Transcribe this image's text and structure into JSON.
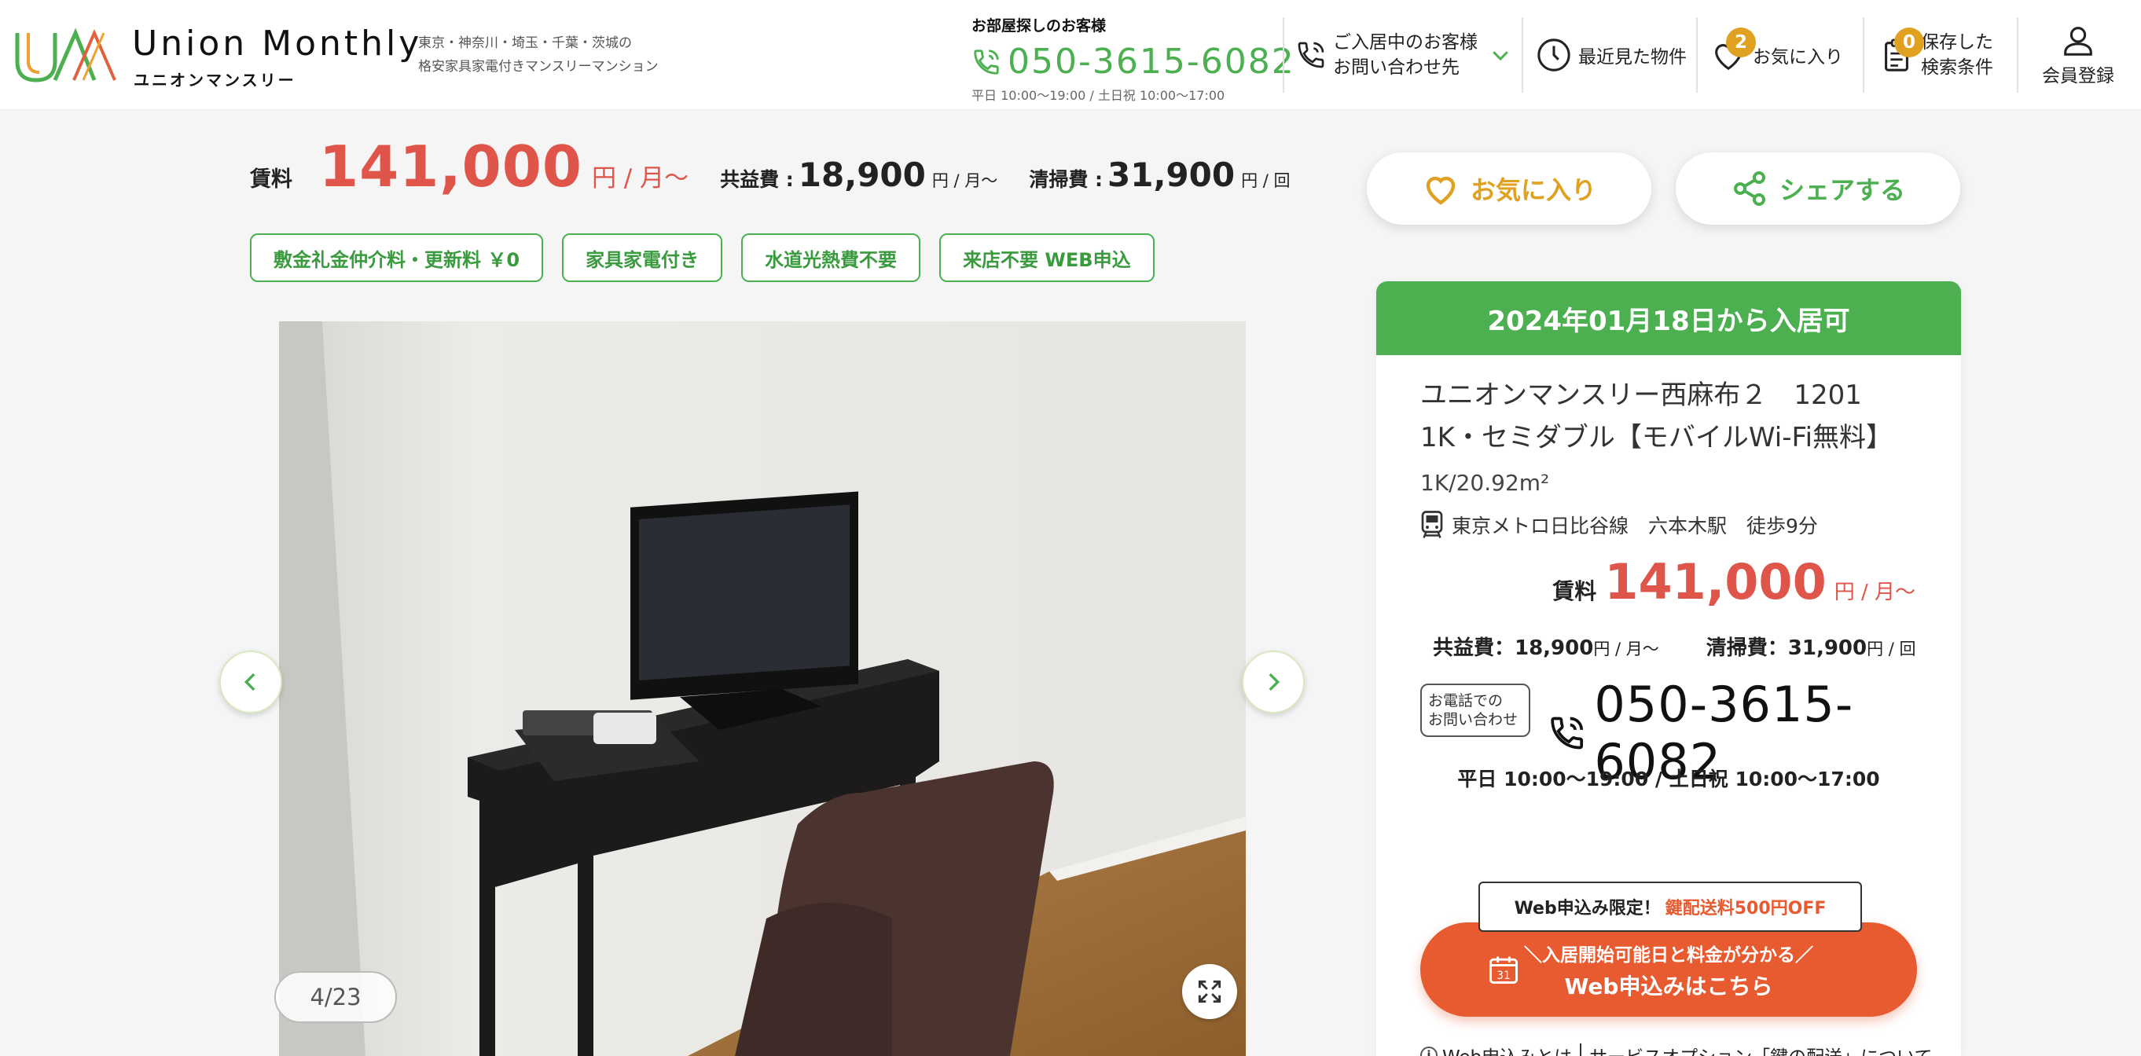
{
  "header": {
    "logo_title": "Union Monthly",
    "logo_sub": "ユニオンマンスリー",
    "tagline_line1": "東京・神奈川・埼玉・千葉・茨城の",
    "tagline_line2": "格安家具家電付きマンスリーマンション",
    "phone_label": "お部屋探しのお客様",
    "phone_number": "050-3615-6082",
    "phone_hours": "平日 10:00〜19:00 / 土日祝 10:00〜17:00",
    "nav": {
      "resident_line1": "ご入居中のお客様",
      "resident_line2": "お問い合わせ先",
      "recent": "最近見た物件",
      "favorites": "お気に入り",
      "favorites_count": "2",
      "saved_line1": "保存した",
      "saved_line2": "検索条件",
      "saved_count": "0",
      "register": "会員登録"
    }
  },
  "pricing": {
    "rent_label": "賃料",
    "rent_value": "141,000",
    "rent_unit": "円 / 月〜",
    "common_fee_label": "共益費 :",
    "common_fee_value": "18,900",
    "common_fee_unit": "円 / 月〜",
    "cleaning_fee_label": "清掃費 :",
    "cleaning_fee_value": "31,900",
    "cleaning_fee_unit": "円 / 回"
  },
  "tags": [
    "敷金礼金仲介料・更新料 ￥0",
    "家具家電付き",
    "水道光熱費不要",
    "来店不要 WEB申込"
  ],
  "gallery": {
    "counter": "4/23"
  },
  "actions": {
    "favorite_label": "お気に入り",
    "share_label": "シェアする"
  },
  "card": {
    "availability": "2024年01月18日から入居可",
    "title": "ユニオンマンスリー西麻布２　1201 1K・セミダブル【モバイルWi-Fi無料】",
    "size": "1K/20.92m²",
    "station": "東京メトロ日比谷線　六本木駅　徒歩9分",
    "rent_label": "賃料",
    "rent_value": "141,000",
    "rent_unit": "円 / 月〜",
    "common_fee": "共益費：18,900",
    "common_fee_unit": "円 / 月〜",
    "cleaning_fee": "清掃費：31,900",
    "cleaning_fee_unit": "円 / 回",
    "contact_line1": "お電話での",
    "contact_line2": "お問い合わせ",
    "phone_number": "050-3615-6082",
    "hours": "平日 10:00〜19:00 / 土日祝 10:00〜17:00",
    "promo_prefix": "Web申込み限定！",
    "promo_highlight": "鍵配送料500円OFF",
    "cta_line1": "＼入居開始可能日と料金が分かる／",
    "cta_line2": "Web申込みはこちら",
    "link_web": "Web申込みとは",
    "link_key": "サービスオプション「鍵の配送」について"
  },
  "colors": {
    "brand_green": "#4caf50",
    "price_red": "#e0554a",
    "cta_orange": "#e85a30",
    "badge": "#e0a020"
  },
  "icons": [
    "phone-icon",
    "chevron-down-icon",
    "clock-icon",
    "heart-icon",
    "clipboard-icon",
    "user-icon",
    "share-icon",
    "train-icon",
    "calendar-icon",
    "expand-icon",
    "chevron-left-icon",
    "chevron-right-icon"
  ]
}
